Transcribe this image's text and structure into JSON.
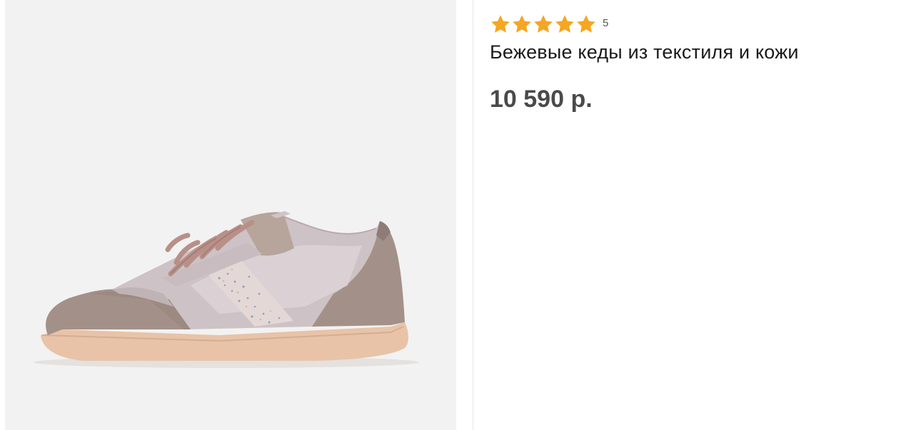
{
  "product": {
    "image": {
      "icon": "sneaker-product-photo",
      "background_color": "#f2f2f2"
    },
    "rating": {
      "stars": 5,
      "max_stars": 5,
      "star_color": "#f5a623",
      "count": "5"
    },
    "title": "Бежевые кеды из текстиля и кожи",
    "price": "10 590 р."
  }
}
